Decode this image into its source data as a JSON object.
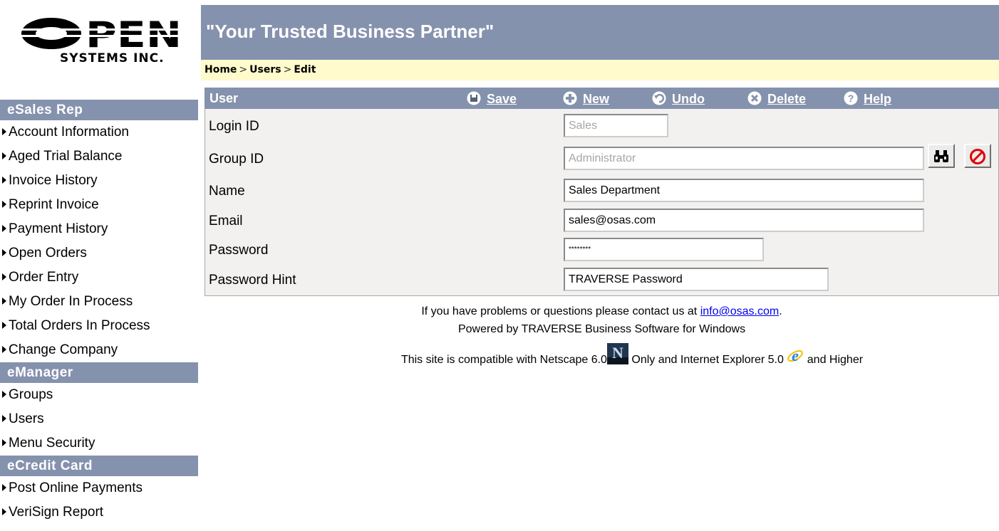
{
  "logo": {
    "word": "OPEN",
    "sub": "SYSTEMS INC."
  },
  "banner": {
    "tagline": "\"Your Trusted Business Partner\""
  },
  "breadcrumb": {
    "home": "Home",
    "users": "Users",
    "edit": "Edit",
    "sep": ">"
  },
  "sidebar": {
    "sections": [
      {
        "title": "eSales Rep",
        "items": [
          "Account Information",
          "Aged Trial Balance",
          "Invoice History",
          "Reprint Invoice",
          "Payment History",
          "Open Orders",
          "Order Entry",
          "My Order In Process",
          "Total Orders In Process",
          "Change Company"
        ]
      },
      {
        "title": "eManager",
        "items": [
          "Groups",
          "Users",
          "Menu Security"
        ]
      },
      {
        "title": "eCredit Card",
        "items": [
          "Post Online Payments",
          "VeriSign Report"
        ]
      }
    ]
  },
  "panel": {
    "title": "User",
    "toolbar": {
      "save": "Save",
      "new": "New",
      "undo": "Undo",
      "delete": "Delete",
      "help": "Help"
    }
  },
  "form": {
    "login_id": {
      "label": "Login ID",
      "value": "Sales"
    },
    "group_id": {
      "label": "Group ID",
      "value": "Administrator"
    },
    "name": {
      "label": "Name",
      "value": "Sales Department"
    },
    "email": {
      "label": "Email",
      "value": "sales@osas.com"
    },
    "password": {
      "label": "Password",
      "value": "********"
    },
    "password_hint": {
      "label": "Password Hint",
      "value": "TRAVERSE Password"
    }
  },
  "footer": {
    "contact_prefix": "If you have problems or questions please contact us at",
    "contact_email": "info@osas.com",
    "contact_suffix": ".",
    "powered": "Powered by TRAVERSE Business Software for Windows",
    "compat_prefix": "This site is compatible with Netscape 6.0",
    "compat_mid": "Only and Internet Explorer 5.0",
    "compat_suffix": "and Higher",
    "netscape_badge": "N",
    "ie_badge": "e"
  },
  "colors": {
    "header": "#8592ad",
    "breadcrumb_bg": "#fffbcc",
    "panel_bg": "#f2f1f0"
  }
}
